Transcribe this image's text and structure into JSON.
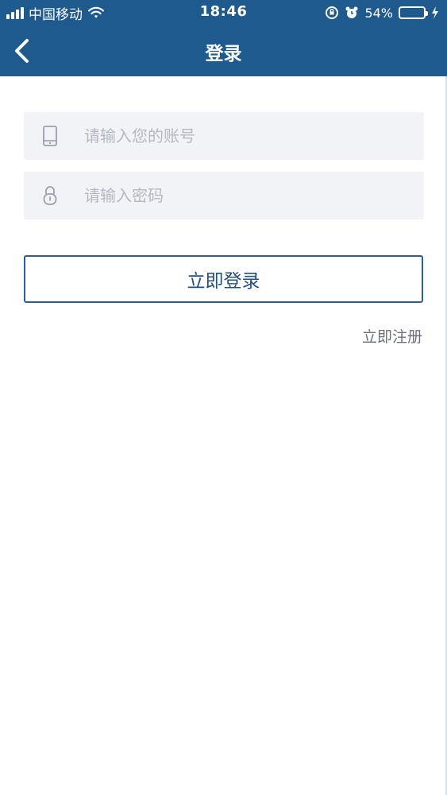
{
  "status_bar": {
    "carrier": "中国移动",
    "time": "18:46",
    "battery_percent_text": "54%",
    "battery_level": 0.54
  },
  "navbar": {
    "title": "登录"
  },
  "form": {
    "account_placeholder": "请输入您的账号",
    "password_placeholder": "请输入密码",
    "login_label": "立即登录",
    "register_label": "立即注册"
  },
  "icons": {
    "back": "chevron-left-icon",
    "account": "phone-icon",
    "password": "lock-icon",
    "signal": "signal-icon",
    "wifi": "wifi-icon",
    "orientation_lock": "rotation-lock-icon",
    "alarm": "alarm-icon",
    "battery": "battery-icon",
    "charging": "charging-icon"
  },
  "colors": {
    "header_bg": "#1f5a8f",
    "field_bg": "#f2f3f7",
    "button_border": "#2b5f95",
    "button_text": "#22507f",
    "battery_fill": "#ffd21f"
  }
}
